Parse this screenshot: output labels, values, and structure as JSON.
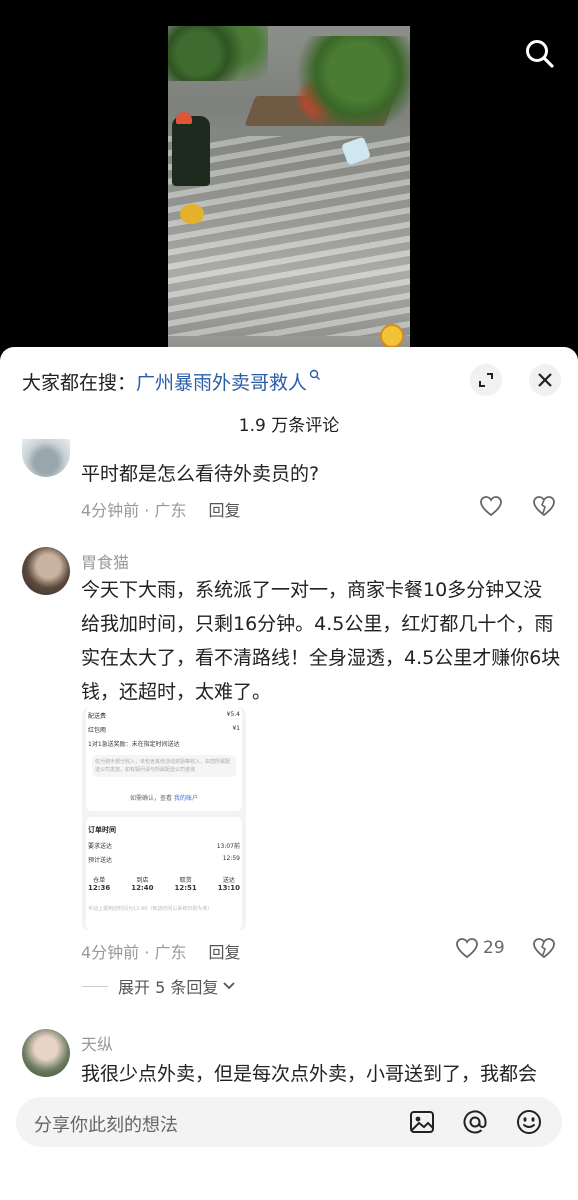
{
  "search_bar": {
    "prefix": "大家都在搜：",
    "keyword": "广州暴雨外卖哥救人"
  },
  "comments_count": "1.9 万条评论",
  "comments": [
    {
      "text": "平时都是怎么看待外卖员的?",
      "time_location": "4分钟前 · 广东",
      "reply": "回复"
    },
    {
      "name": "胃食猫",
      "text": "今天下大雨，系统派了一对一，商家卡餐10多分钟又没给我加时间，只剩16分钟。4.5公里，红灯都几十个，雨实在太大了，看不清路线！全身湿透，4.5公里才赚你6块钱，还超时，太难了。",
      "time_location": "4分钟前 · 广东",
      "reply": "回复",
      "likes": "29",
      "expand": "展开 5 条回复",
      "image": {
        "row1_label": "配送费",
        "row1_value": "¥5.4",
        "row2_label": "红包雨",
        "row2_value": "¥1",
        "row3": "1对1急送奖励：未在指定时间送达",
        "note": "仅为骑手部分收入，未包含其他活动奖励等收入，由您所属配送公司发放，如有疑问请与所属配送公司咨询",
        "account_prefix": "如需确认，查看",
        "account_link": "我的账户",
        "order_time_title": "订单时间",
        "required_label": "要求送达",
        "required_value": "13:07前",
        "estimated_label": "预计送达",
        "estimated_value": "12:59",
        "col1_label": "仓单",
        "col1_time": "12:36",
        "col2_label": "到店",
        "col2_time": "12:40",
        "col3_label": "取货",
        "col3_time": "12:51",
        "col4_label": "送达",
        "col4_time": "13:10",
        "footnote": "手动上报到店时间为12:40（到店时间以系统识别为准）"
      }
    },
    {
      "name": "天纵",
      "text": "我很少点外卖，但是每次点外卖，小哥送到了，我都会"
    }
  ],
  "input": {
    "placeholder": "分享你此刻的想法"
  },
  "icons": {
    "search": "search-icon",
    "expand": "fullscreen-icon",
    "close": "close-icon",
    "like": "heart-icon",
    "dislike": "broken-heart-icon",
    "image": "image-icon",
    "mention": "at-icon",
    "emoji": "emoji-icon"
  }
}
